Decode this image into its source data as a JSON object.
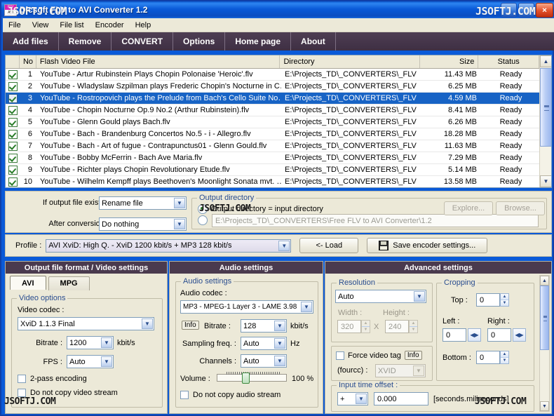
{
  "window": {
    "title": "Dicsoft FLV to AVI Converter 1.2",
    "icon_top": "FLV",
    "icon_bottom": "AVI",
    "buttons": {
      "minimize": "_",
      "maximize": "□",
      "close": "✕"
    }
  },
  "watermark": {
    "text": "JSOFTJ.COM"
  },
  "menu": {
    "items": [
      "File",
      "View",
      "File list",
      "Encoder",
      "Help"
    ]
  },
  "toolbar": {
    "items": [
      "Add files",
      "Remove",
      "CONVERT",
      "Options",
      "Home page",
      "About"
    ]
  },
  "filelist": {
    "columns": [
      "No",
      "Flash Video File",
      "Directory",
      "Size",
      "Status"
    ],
    "rows": [
      {
        "no": "1",
        "checked": true,
        "file": "YouTube - Artur Rubinstein Plays Chopin Polonaise 'Heroic'.flv",
        "dir": "E:\\Projects_TD\\_CONVERTERS\\_FLV",
        "size": "11.43 MB",
        "status": "Ready",
        "selected": false
      },
      {
        "no": "2",
        "checked": true,
        "file": "YouTube - Wladyslaw Szpilman plays Frederic Chopin's Nocturne in C…",
        "dir": "E:\\Projects_TD\\_CONVERTERS\\_FLV",
        "size": "6.25 MB",
        "status": "Ready",
        "selected": false
      },
      {
        "no": "3",
        "checked": true,
        "file": "YouTube - Rostropovich plays the Prelude from Bach's Cello Suite No…",
        "dir": "E:\\Projects_TD\\_CONVERTERS\\_FLV",
        "size": "4.59 MB",
        "status": "Ready",
        "selected": true
      },
      {
        "no": "4",
        "checked": true,
        "file": "YouTube - Chopin Nocturne Op.9 No.2 (Arthur Rubinstein).flv",
        "dir": "E:\\Projects_TD\\_CONVERTERS\\_FLV",
        "size": "8.41 MB",
        "status": "Ready",
        "selected": false
      },
      {
        "no": "5",
        "checked": true,
        "file": "YouTube - Glenn Gould plays Bach.flv",
        "dir": "E:\\Projects_TD\\_CONVERTERS\\_FLV",
        "size": "6.26 MB",
        "status": "Ready",
        "selected": false
      },
      {
        "no": "6",
        "checked": true,
        "file": "YouTube - Bach - Brandenburg Concertos No.5 - i - Allegro.flv",
        "dir": "E:\\Projects_TD\\_CONVERTERS\\_FLV",
        "size": "18.28 MB",
        "status": "Ready",
        "selected": false
      },
      {
        "no": "7",
        "checked": true,
        "file": "YouTube - Bach - Art of fugue - Contrapunctus01 - Glenn Gould.flv",
        "dir": "E:\\Projects_TD\\_CONVERTERS\\_FLV",
        "size": "11.63 MB",
        "status": "Ready",
        "selected": false
      },
      {
        "no": "8",
        "checked": true,
        "file": "YouTube - Bobby McFerrin - Bach Ave Maria.flv",
        "dir": "E:\\Projects_TD\\_CONVERTERS\\_FLV",
        "size": "7.29 MB",
        "status": "Ready",
        "selected": false
      },
      {
        "no": "9",
        "checked": true,
        "file": "YouTube - Richter plays Chopin Revolutionary Etude.flv",
        "dir": "E:\\Projects_TD\\_CONVERTERS\\_FLV",
        "size": "5.14 MB",
        "status": "Ready",
        "selected": false
      },
      {
        "no": "10",
        "checked": true,
        "file": "YouTube - Wilhelm Kempff plays Beethoven's Moonlight Sonata mvt. …",
        "dir": "E:\\Projects_TD\\_CONVERTERS\\_FLV",
        "size": "13.58 MB",
        "status": "Ready",
        "selected": false
      }
    ]
  },
  "output_options": {
    "if_exists_label": "If output file exists :",
    "if_exists_value": "Rename file",
    "after_conversion_label": "After conversion :",
    "after_conversion_value": "Do nothing",
    "group_caption": "Output directory",
    "radio_same_label": "Output directory = input directory",
    "radio_same_selected": true,
    "radio_custom_selected": false,
    "custom_path": "E:\\Projects_TD\\_CONVERTERS\\Free FLV to AVI Converter\\1.2",
    "explore_button": "Explore...",
    "browse_button": "Browse..."
  },
  "profile": {
    "label": "Profile :",
    "value": "AVI XviD: High Q. - XviD 1200 kbit/s + MP3 128 kbit/s",
    "load_button": "<- Load",
    "save_button": "Save encoder settings..."
  },
  "video_panel": {
    "title": "Output file format / Video settings",
    "tabs": [
      "AVI",
      "MPG"
    ],
    "active_tab": "AVI",
    "group_caption": "Video options",
    "codec_label": "Video codec :",
    "codec_value": "XviD 1.1.3 Final",
    "bitrate_label": "Bitrate :",
    "bitrate_value": "1200",
    "bitrate_unit": "kbit/s",
    "fps_label": "FPS :",
    "fps_value": "Auto",
    "two_pass_label": "2-pass encoding",
    "two_pass_checked": false,
    "no_copy_video_label": "Do not copy video stream",
    "no_copy_video_checked": false
  },
  "audio_panel": {
    "title": "Audio settings",
    "group_caption": "Audio settings",
    "codec_label": "Audio codec :",
    "codec_value": "MP3 - MPEG-1 Layer 3 - LAME 3.98",
    "info_button": "Info",
    "bitrate_label": "Bitrate :",
    "bitrate_value": "128",
    "bitrate_unit": "kbit/s",
    "sampling_label": "Sampling freq. :",
    "sampling_value": "Auto",
    "sampling_unit": "Hz",
    "channels_label": "Channels :",
    "channels_value": "Auto",
    "volume_label": "Volume :",
    "volume_value": "100 %",
    "no_copy_audio_label": "Do not copy audio stream",
    "no_copy_audio_checked": false
  },
  "advanced_panel": {
    "title": "Advanced settings",
    "resolution_caption": "Resolution",
    "resolution_value": "Auto",
    "width_label": "Width :",
    "width_value": "320",
    "x_label": "X",
    "height_label": "Height :",
    "height_value": "240",
    "force_tag_label": "Force video tag",
    "force_tag_checked": false,
    "info_button": "Info",
    "fourcc_label": "(fourcc) :",
    "fourcc_value": "XVID",
    "cropping_caption": "Cropping",
    "top_label": "Top :",
    "top_value": "0",
    "left_label": "Left :",
    "left_value": "0",
    "right_label": "Right :",
    "right_value": "0",
    "bottom_label": "Bottom :",
    "bottom_value": "0",
    "offset_caption": "Input time offset :",
    "offset_sign": "+",
    "offset_value": "0.000",
    "offset_unit": "[seconds.miliseconds]"
  }
}
